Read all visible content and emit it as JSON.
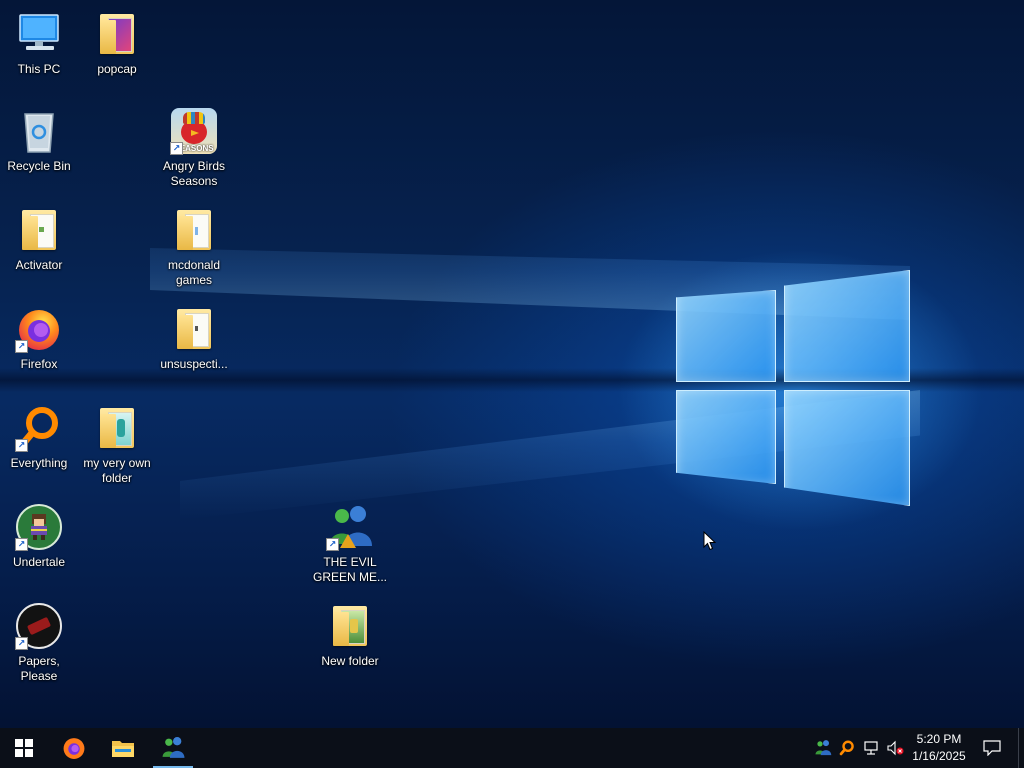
{
  "desktop": {
    "icons": [
      {
        "label": "This PC",
        "icon": "computer-icon"
      },
      {
        "label": "popcap",
        "icon": "folder-icon"
      },
      {
        "label": "Recycle Bin",
        "icon": "recycle-bin-icon"
      },
      {
        "label": "Angry Birds Seasons",
        "icon": "angry-birds-icon",
        "badge": "SEASONS"
      },
      {
        "label": "Activator",
        "icon": "folder-icon"
      },
      {
        "label": "mcdonald games",
        "icon": "folder-icon"
      },
      {
        "label": "Firefox",
        "icon": "firefox-icon"
      },
      {
        "label": "unsuspecti...",
        "icon": "folder-icon"
      },
      {
        "label": "Everything",
        "icon": "everything-search-icon"
      },
      {
        "label": "my very own folder",
        "icon": "folder-icon"
      },
      {
        "label": "Undertale",
        "icon": "undertale-icon"
      },
      {
        "label": "THE EVIL GREEN ME...",
        "icon": "msn-messenger-icon"
      },
      {
        "label": "Papers, Please",
        "icon": "papers-please-icon"
      },
      {
        "label": "New folder",
        "icon": "folder-icon"
      }
    ]
  },
  "taskbar": {
    "start": "start-icon",
    "pinned": [
      {
        "name": "Firefox",
        "icon": "firefox-icon"
      },
      {
        "name": "File Explorer",
        "icon": "file-explorer-icon"
      },
      {
        "name": "Messenger",
        "icon": "msn-messenger-icon",
        "active": true
      }
    ],
    "tray": {
      "time": "5:20 PM",
      "date": "1/16/2025"
    }
  },
  "colors": {
    "accent": "#76b9ed",
    "taskbar_bg": "#0b0f18",
    "wallpaper_blue": "#072a62"
  }
}
